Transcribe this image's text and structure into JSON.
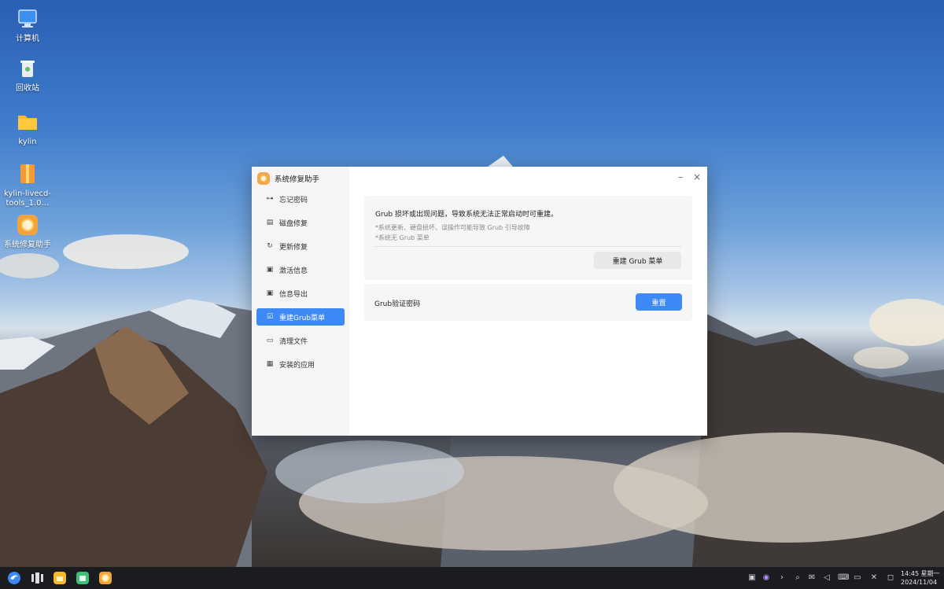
{
  "desktop": {
    "icons": [
      {
        "label": "计算机",
        "icon": "computer-icon"
      },
      {
        "label": "回收站",
        "icon": "trash-icon"
      },
      {
        "label": "kylin",
        "icon": "folder-icon"
      },
      {
        "label": "kylin-livecd-",
        "label2": "tools_1.0…",
        "icon": "package-icon"
      },
      {
        "label": "系统修复助手",
        "icon": "repair-app-icon"
      }
    ]
  },
  "window": {
    "title": "系统修复助手",
    "controls": {
      "minimize": "–",
      "close": "×"
    },
    "sidebar": [
      {
        "label": "忘记密码",
        "icon": "key-icon",
        "glyph": "⊶"
      },
      {
        "label": "磁盘修复",
        "icon": "disk-icon",
        "glyph": "▤"
      },
      {
        "label": "更新修复",
        "icon": "refresh-icon",
        "glyph": "↻"
      },
      {
        "label": "激活信息",
        "icon": "activation-icon",
        "glyph": "▣"
      },
      {
        "label": "信息导出",
        "icon": "export-icon",
        "glyph": "▣"
      },
      {
        "label": "重建Grub菜单",
        "icon": "grub-icon",
        "glyph": "☑",
        "active": true
      },
      {
        "label": "清理文件",
        "icon": "folder-outline-icon",
        "glyph": "▭"
      },
      {
        "label": "安装的应用",
        "icon": "apps-grid-icon",
        "glyph": "▦"
      }
    ],
    "grub_panel": {
      "title": "Grub 损坏或出现问题，导致系统无法正常启动时可重建。",
      "notes": [
        "*系统更新、硬盘损坏、误操作可能导致 Grub 引导故障",
        "*系统无 Grub 菜单"
      ],
      "button": "重建 Grub 菜单"
    },
    "password_panel": {
      "label": "Grub验证密码",
      "button": "重置"
    }
  },
  "taskbar": {
    "clock_time": "14:45 星期一",
    "clock_date": "2024/11/04",
    "accent": "#3d8af7"
  }
}
